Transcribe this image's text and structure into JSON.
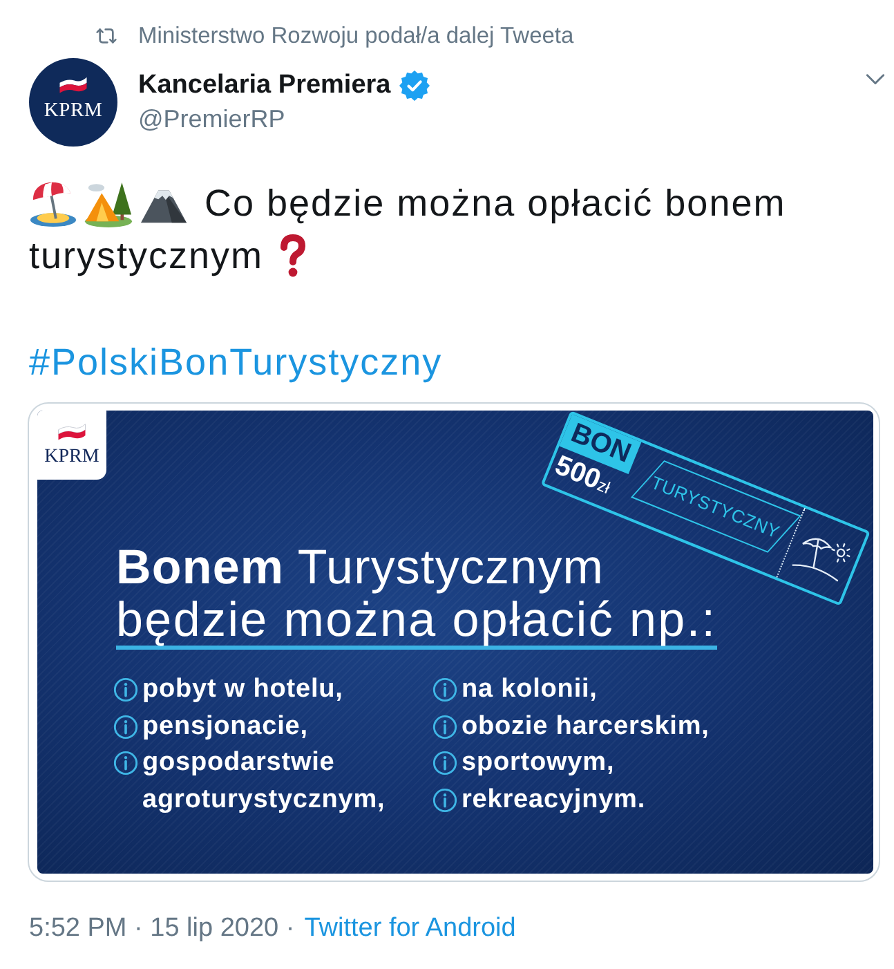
{
  "retweet": {
    "text": "Ministerstwo Rozwoju podał/a dalej Tweeta"
  },
  "author": {
    "avatar_text": "KPRM",
    "name": "Kancelaria Premiera",
    "verified": true,
    "handle": "@PremierRP"
  },
  "tweet": {
    "lines": [
      "Co będzie można opłacić bonem",
      "turystycznym"
    ],
    "hashtag": "#PolskiBonTurystyczny"
  },
  "media": {
    "logo_text": "KPRM",
    "headline": "**Bonem** Turystycznym",
    "subheadline": "będzie można opłacić np.:",
    "voucher": {
      "label": "BON",
      "amount": "500",
      "currency": "zł",
      "type": "TURYSTYCZNY"
    },
    "columns": [
      [
        "pobyt w hotelu,",
        "pensjonacie,",
        "gospodarstwie agroturystycznym,"
      ],
      [
        "na kolonii,",
        "obozie harcerskim,",
        "sportowym,",
        "rekreacyjnym."
      ]
    ]
  },
  "footer": {
    "timestamp": "5:52 PM · 15 lip 2020 ·",
    "source": "Twitter for Android"
  }
}
